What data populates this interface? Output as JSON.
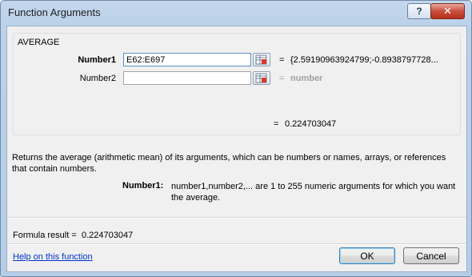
{
  "window": {
    "title": "Function Arguments",
    "help_glyph": "?",
    "close_glyph": "✕"
  },
  "function": {
    "name": "AVERAGE",
    "args": [
      {
        "label": "Number1",
        "value": "E62:E697",
        "result": "{2.59190963924799;-0.8938797728..."
      },
      {
        "label": "Number2",
        "value": "",
        "result": "number"
      }
    ],
    "equals": "=",
    "function_result": "0.224703047"
  },
  "description": "Returns the average (arithmetic mean) of its arguments, which can be numbers or names, arrays, or references that contain numbers.",
  "arg_help": {
    "label": "Number1:",
    "text": "number1,number2,... are 1 to 255 numeric arguments for which you want the average."
  },
  "formula_result": {
    "label": "Formula result =",
    "value": "0.224703047"
  },
  "footer": {
    "help_link": "Help on this function",
    "ok": "OK",
    "cancel": "Cancel"
  },
  "colors": {
    "title_bg": "#bcd2ea",
    "client_bg": "#f0f0f0",
    "link": "#0033cc",
    "close_red": "#c9503c"
  }
}
